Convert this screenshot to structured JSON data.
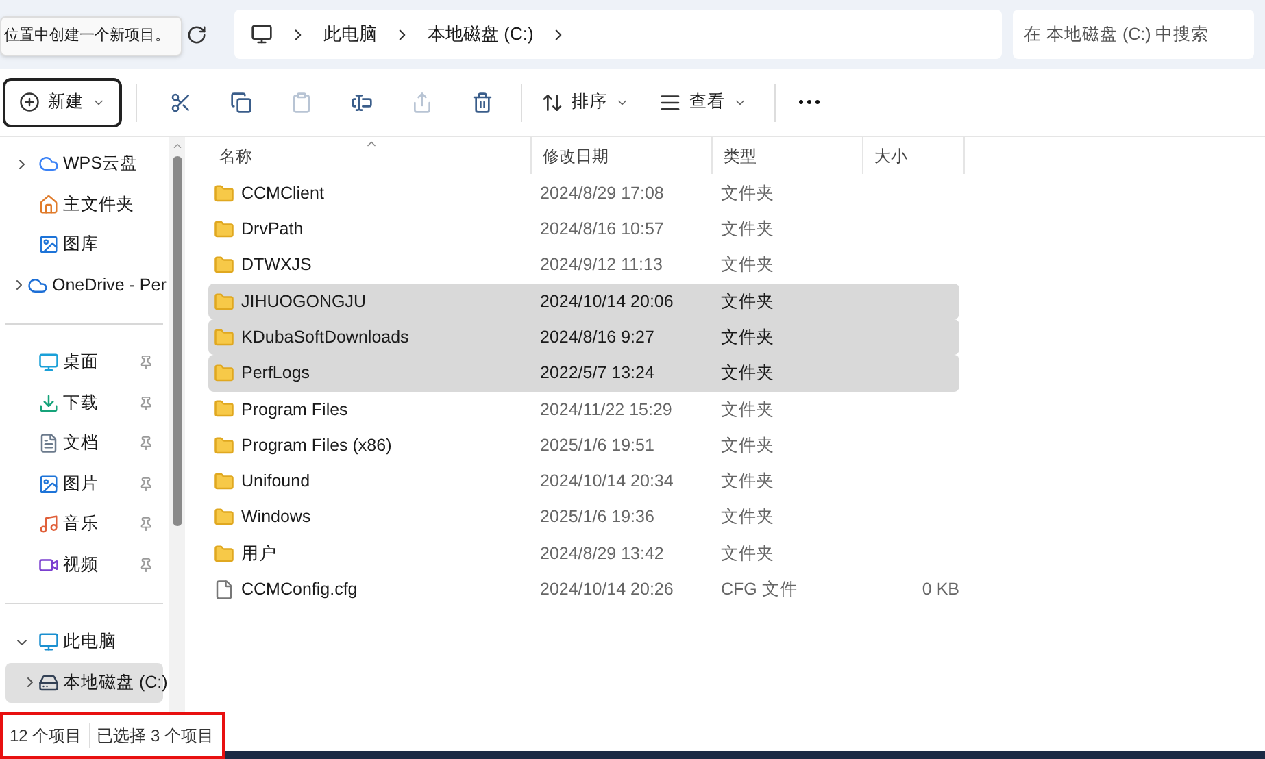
{
  "tooltip": "位置中创建一个新项目。",
  "breadcrumb": [
    "此电脑",
    "本地磁盘 (C:)"
  ],
  "search": {
    "placeholder": "在 本地磁盘 (C:) 中搜索"
  },
  "toolbar": [
    {
      "kind": "new",
      "label": "新建",
      "disabled": false
    },
    {
      "kind": "cut",
      "disabled": false
    },
    {
      "kind": "copy",
      "disabled": false
    },
    {
      "kind": "paste",
      "disabled": true
    },
    {
      "kind": "rename",
      "disabled": false
    },
    {
      "kind": "share",
      "disabled": true
    },
    {
      "kind": "delete",
      "disabled": false
    },
    {
      "kind": "sort",
      "label": "排序",
      "disabled": false
    },
    {
      "kind": "view",
      "label": "查看",
      "disabled": false
    },
    {
      "kind": "more",
      "disabled": false
    }
  ],
  "sidebar": {
    "sections": [
      [
        {
          "kind": "cloud",
          "label": "WPS云盘",
          "expanded": false,
          "selected": false
        },
        {
          "kind": "home",
          "label": "主文件夹",
          "selected": false
        },
        {
          "kind": "gallery",
          "label": "图库",
          "selected": false
        },
        {
          "kind": "onedrive",
          "label": "OneDrive - Per",
          "expanded": false,
          "selected": false
        }
      ],
      [
        {
          "kind": "desktop",
          "label": "桌面",
          "pinned": true,
          "selected": false
        },
        {
          "kind": "download",
          "label": "下载",
          "pinned": true,
          "selected": false
        },
        {
          "kind": "document",
          "label": "文档",
          "pinned": true,
          "selected": false
        },
        {
          "kind": "picture",
          "label": "图片",
          "pinned": true,
          "selected": false
        },
        {
          "kind": "music",
          "label": "音乐",
          "pinned": true,
          "selected": false
        },
        {
          "kind": "video",
          "label": "视频",
          "pinned": true,
          "selected": false
        }
      ],
      [
        {
          "kind": "pc",
          "label": "此电脑",
          "expanded": true,
          "selected": false,
          "children": [
            {
              "kind": "drive",
              "label": "本地磁盘 (C:)",
              "expanded": false,
              "selected": true
            }
          ]
        }
      ]
    ]
  },
  "table": {
    "columns": [
      "名称",
      "修改日期",
      "类型",
      "大小"
    ],
    "rows": [
      {
        "kind": "folder",
        "name": "CCMClient",
        "date": "2024/8/29 17:08",
        "type": "文件夹",
        "selected": false
      },
      {
        "kind": "folder",
        "name": "DrvPath",
        "date": "2024/8/16 10:57",
        "type": "文件夹",
        "selected": false
      },
      {
        "kind": "folder",
        "name": "DTWXJS",
        "date": "2024/9/12 11:13",
        "type": "文件夹",
        "selected": false
      },
      {
        "kind": "folder",
        "name": "JIHUOGONGJU",
        "date": "2024/10/14 20:06",
        "type": "文件夹",
        "selected": true
      },
      {
        "kind": "folder",
        "name": "KDubaSoftDownloads",
        "date": "2024/8/16 9:27",
        "type": "文件夹",
        "selected": true
      },
      {
        "kind": "folder",
        "name": "PerfLogs",
        "date": "2022/5/7 13:24",
        "type": "文件夹",
        "selected": true
      },
      {
        "kind": "folder",
        "name": "Program Files",
        "date": "2024/11/22 15:29",
        "type": "文件夹",
        "selected": false
      },
      {
        "kind": "folder",
        "name": "Program Files (x86)",
        "date": "2025/1/6 19:51",
        "type": "文件夹",
        "selected": false
      },
      {
        "kind": "folder",
        "name": "Unifound",
        "date": "2024/10/14 20:34",
        "type": "文件夹",
        "selected": false
      },
      {
        "kind": "folder",
        "name": "Windows",
        "date": "2025/1/6 19:36",
        "type": "文件夹",
        "selected": false
      },
      {
        "kind": "folder",
        "name": "用户",
        "date": "2024/8/29 13:42",
        "type": "文件夹",
        "selected": false
      },
      {
        "kind": "file",
        "name": "CCMConfig.cfg",
        "date": "2024/10/14 20:26",
        "type": "CFG 文件",
        "size": "0 KB",
        "selected": false
      }
    ]
  },
  "status_bar": {
    "items": [
      "12 个项目",
      "已选择 3 个项目"
    ],
    "highlighted": true
  }
}
